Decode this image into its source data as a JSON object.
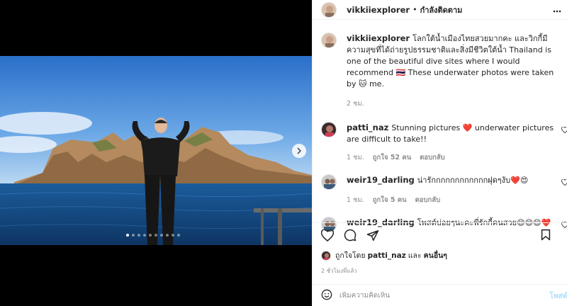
{
  "post": {
    "username": "vikkiiexplorer",
    "separator": "•",
    "follow_status": "กำลังติดตาม",
    "caption": "โลกใต้น้ำเมืองไทยสวยมากคะ และวิกกี้มีความสุขที่ได้ถ่ายรูปธรรมชาติและสิ่งมีชีวิตใต้น้ำ Thailand is one of the beautiful dive sites where I would recommend 🇹🇭 These underwater photos were taken by 🐱 me.",
    "caption_time": "2 ชม."
  },
  "comments": [
    {
      "user": "patti_naz",
      "text": "Stunning pictures ❤️ underwater pictures are difficult to take!!",
      "time": "1 ชม.",
      "likes": "ถูกใจ 52 คน",
      "reply": "ตอบกลับ"
    },
    {
      "user": "weir19_darling",
      "text": "น่ารักกกกกกกกกกกกฝุดๆงับ❤️😍",
      "time": "1 ชม.",
      "likes": "ถูกใจ 5 คน",
      "reply": "ตอบกลับ"
    },
    {
      "user": "weir19_darling",
      "text": "โพสต์บ่อยๆนะคะพี่รักกี้คนสวย😊😊😊❤️",
      "time": "",
      "likes": "",
      "reply": ""
    }
  ],
  "likes_line": {
    "prefix": "ถูกใจโดย",
    "user": "patti_naz",
    "conj": "และ",
    "others": "คนอื่นๆ"
  },
  "timestamp": "2 ชั่วโมงที่แล้ว",
  "composer": {
    "placeholder": "เพิ่มความคิดเห็น",
    "post_label": "โพสต์"
  },
  "carousel": {
    "count": 10,
    "active_index": 0
  },
  "colors": {
    "like_red": "#ed4956",
    "link_blue": "#b2dffc",
    "muted": "#8e8e8e"
  }
}
